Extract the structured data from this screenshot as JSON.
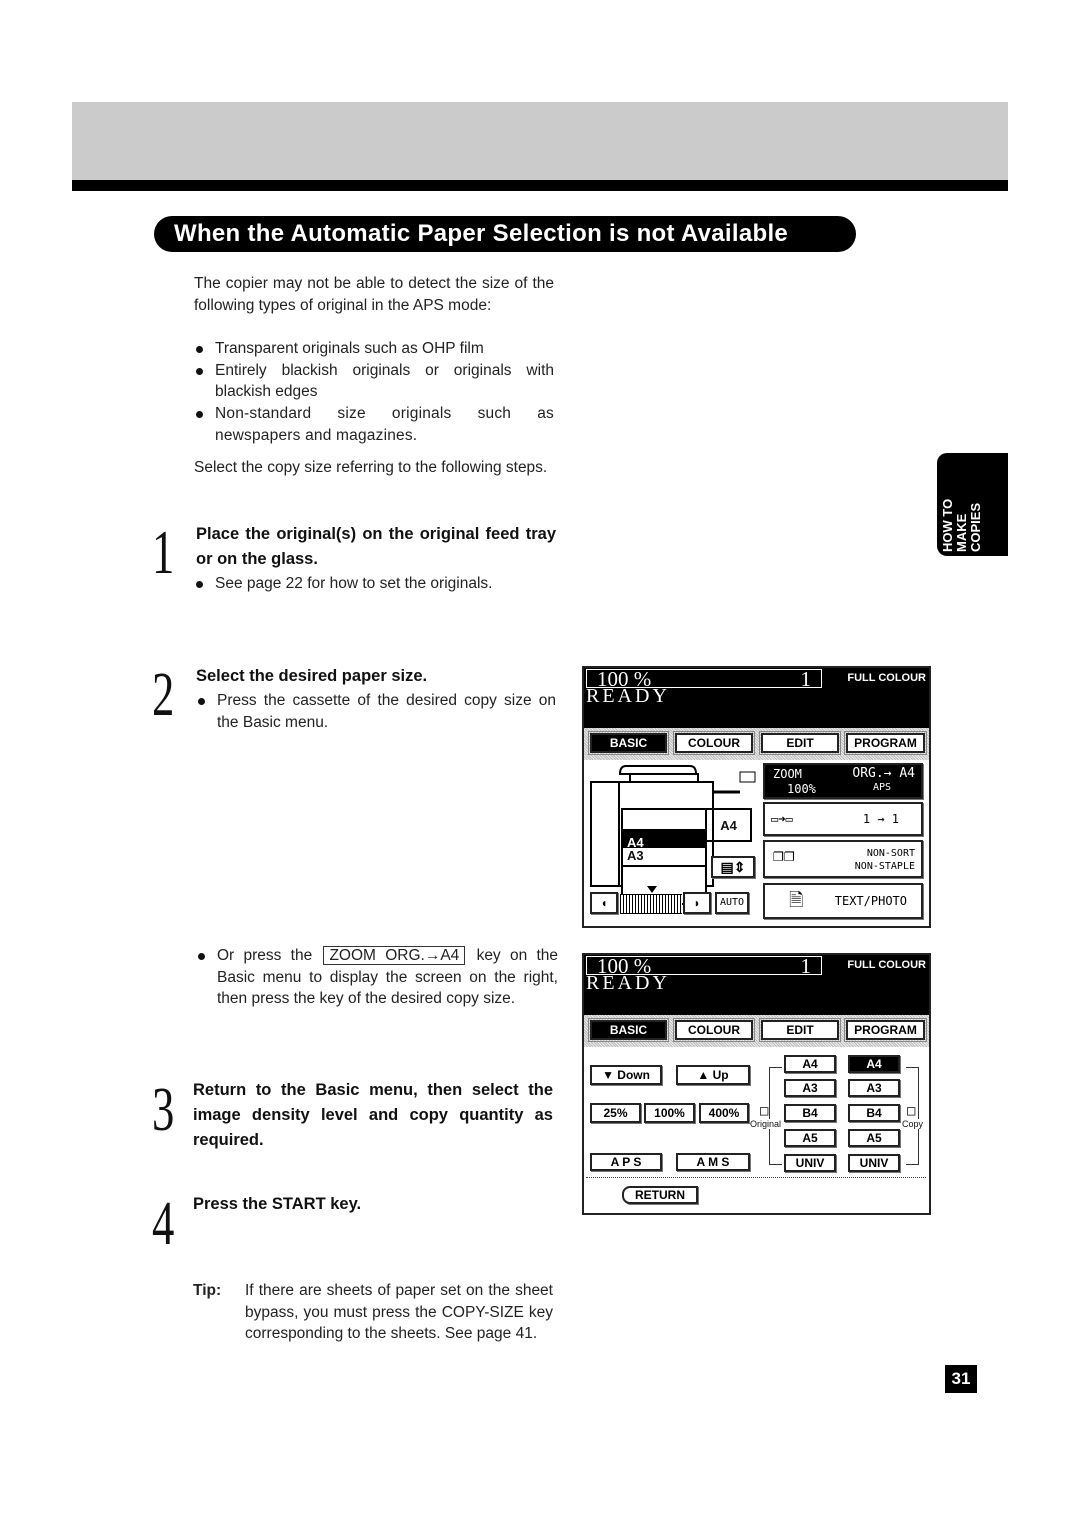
{
  "section_title": "When the Automatic Paper Selection is not Available",
  "intro": {
    "paragraph": "The copier may not be able to detect the size of the following types of original in the APS mode:",
    "bullets": [
      "Transparent originals such as OHP film",
      "Entirely blackish originals or originals with blackish edges",
      "Non-standard size originals such as newspapers and magazines."
    ],
    "closing": "Select the copy size referring to the following steps."
  },
  "steps": [
    {
      "number": "1",
      "title": "Place the original(s) on the original feed tray or on the glass.",
      "bullets": [
        "See page 22 for how to set the originals."
      ]
    },
    {
      "number": "2",
      "title": "Select the desired paper size.",
      "bullets": [
        "Press the cassette of the desired copy size on the Basic menu."
      ],
      "alt_bullet": {
        "prefix": "Or press the",
        "key": "ZOOM ORG.→A4",
        "suffix": "key on the Basic menu to display the screen on the right, then press the key of the desired copy size."
      }
    },
    {
      "number": "3",
      "title": "Return to the Basic menu, then select the image density level and copy quantity as required."
    },
    {
      "number": "4",
      "title": "Press the START key."
    }
  ],
  "tip": {
    "label": "Tip:",
    "text": "If there are sheets of paper set on the sheet bypass, you must press the COPY-SIZE key corresponding to the sheets. See page 41."
  },
  "side_tab": {
    "lines": [
      "HOW TO",
      "MAKE",
      "COPIES"
    ]
  },
  "page_number": "31",
  "screen1": {
    "zoom": "100  %",
    "quantity": "1",
    "colour_mode": "FULL COLOUR",
    "status": "READY",
    "tabs": [
      "BASIC",
      "COLOUR",
      "EDIT",
      "PROGRAM"
    ],
    "active_tab": "BASIC",
    "cassettes": [
      "",
      "A4",
      "A3",
      ""
    ],
    "selected_cassette": "A4",
    "bypass_size": "A4",
    "density_auto": "AUTO",
    "density_level_fraction": 0.5,
    "zoom_key": {
      "line1": "ZOOM",
      "line2": "100%",
      "org": "ORG.→ A4",
      "aps": "APS"
    },
    "duplex": "1 → 1",
    "finisher": [
      "NON-SORT",
      "NON-STAPLE"
    ],
    "original_mode": "TEXT/PHOTO"
  },
  "screen2": {
    "zoom": "100  %",
    "quantity": "1",
    "colour_mode": "FULL COLOUR",
    "status": "READY",
    "tabs": [
      "BASIC",
      "COLOUR",
      "EDIT",
      "PROGRAM"
    ],
    "active_tab": "BASIC",
    "down": "▼ Down",
    "up": "▲ Up",
    "presets": [
      "25%",
      "100%",
      "400%"
    ],
    "aps": "A P S",
    "ams": "A M S",
    "original_label": "Original",
    "copy_label": "Copy",
    "original_sizes": [
      "A4",
      "A3",
      "B4",
      "A5",
      "UNIV"
    ],
    "copy_sizes": [
      "A4",
      "A3",
      "B4",
      "A5",
      "UNIV"
    ],
    "selected_copy_size": "A4",
    "return": "RETURN"
  }
}
